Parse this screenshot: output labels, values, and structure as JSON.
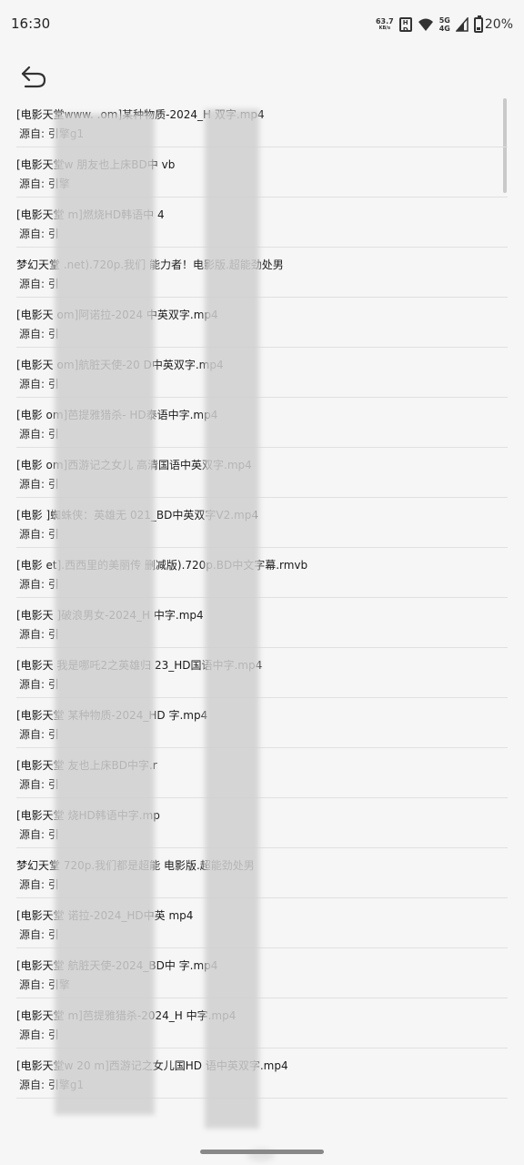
{
  "status_bar": {
    "time": "16:30",
    "net_speed_value": "63.7",
    "net_speed_unit": "KB/s",
    "hd_label_top": "H",
    "hd_label_bottom": "D",
    "network_top": "5G",
    "network_bottom": "4G",
    "battery_percent": "20%"
  },
  "toolbar": {
    "back_icon": "back-arrow-icon"
  },
  "items": [
    {
      "title": "[电影天堂www.          .om]某种物质-2024_H          双字.mp4",
      "source": "源自: 引擎g1"
    },
    {
      "title": "[电影天堂w                    朋友也上床BD中          vb",
      "source": "源自: 引擎"
    },
    {
      "title": "[电影天堂                    m]燃烧HD韩语中          4",
      "source": "源自: 引"
    },
    {
      "title": "梦幻天堂                    .net).720p.我们          能力者！电影版.超能劲处男",
      "source": "源自: 引"
    },
    {
      "title": "[电影天                    om]阿诺拉-2024          中英双字.mp4",
      "source": "源自: 引"
    },
    {
      "title": "[电影天                    om]航脏天使-20          D中英双字.mp4",
      "source": "源自: 引"
    },
    {
      "title": "[电影                    om]芭提雅猎杀-          HD泰语中字.mp4",
      "source": "源自: 引"
    },
    {
      "title": "[电影                    om]西游记之女儿          高清国语中英双字.mp4",
      "source": "源自: 引"
    },
    {
      "title": "[电影                    ]蜘蛛侠：英雄无          021_BD中英双字V2.mp4",
      "source": "源自: 引"
    },
    {
      "title": "[电影                    et].西西里的美丽传          删减版).720p.BD中文字幕.rmvb",
      "source": "源自: 引"
    },
    {
      "title": "[电影天                    ]破浪男女-2024_H          中字.mp4",
      "source": "源自: 引"
    },
    {
      "title": "[电影天                    我是哪吒2之英雄归          23_HD国语中字.mp4",
      "source": "源自: 引"
    },
    {
      "title": "[电影天堂                    某种物质-2024_HD          字.mp4",
      "source": "源自: 引"
    },
    {
      "title": "[电影天堂                    友也上床BD中字.r",
      "source": "源自: 引"
    },
    {
      "title": "[电影天堂                    烧HD韩语中字.mp",
      "source": "源自: 引"
    },
    {
      "title": "梦幻天堂                    720p.我们都是超能          电影版.超能劲处男",
      "source": "源自: 引"
    },
    {
      "title": "[电影天堂                    诺拉-2024_HD中英          mp4",
      "source": "源自: 引"
    },
    {
      "title": "[电影天堂                    航脏天使-2024_BD中          字.mp4",
      "source": "源自: 引擎"
    },
    {
      "title": "[电影天堂                    m]芭提雅猎杀-2024_H          中字.mp4",
      "source": "源自: 引"
    },
    {
      "title": "[电影天堂w          20          m]西游记之女儿国HD          语中英双字.mp4",
      "source": "源自: 引擎g1"
    }
  ]
}
